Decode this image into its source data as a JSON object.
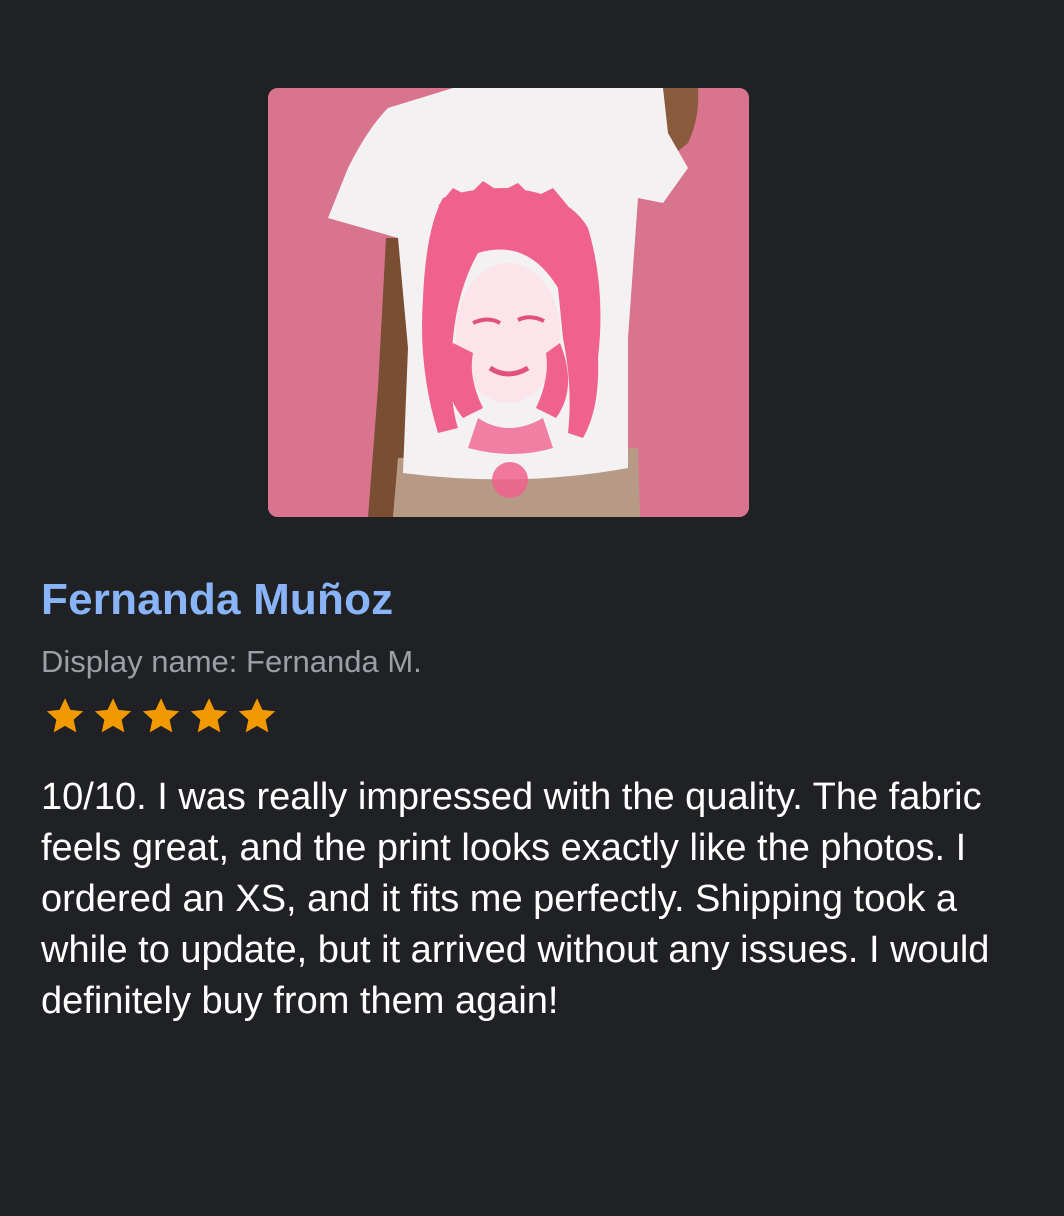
{
  "review": {
    "photo_alt": "T-shirt photo",
    "reviewer_name": "Fernanda Muñoz",
    "display_name_label": "Display name:",
    "display_name_value": "Fernanda M.",
    "rating": 5,
    "rating_max": 5,
    "star_color": "#f29900",
    "text": "10/10. I was really impressed with the quality. The fabric feels great, and the print looks exactly like the photos. I ordered an XS, and it fits me perfectly. Shipping took a while to update, but it arrived without any issues. I would definitely buy from them again!"
  },
  "colors": {
    "background": "#202124",
    "name": "#8ab4f8",
    "secondary_text": "#9aa0a6",
    "body_text": "#ffffff",
    "photo_background": "#d9748f"
  }
}
